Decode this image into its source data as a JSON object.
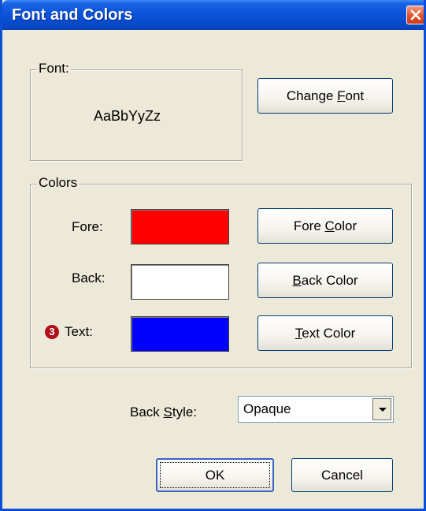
{
  "window": {
    "title": "Font and Colors"
  },
  "font_group": {
    "legend": "Font:",
    "sample_text": "AaBbYyZz",
    "change_font_button": {
      "pre": "Change ",
      "mnemonic": "F",
      "post": "ont"
    }
  },
  "colors_group": {
    "legend": "Colors",
    "rows": [
      {
        "label": "Fore:",
        "color": "#ff0000",
        "button": {
          "pre": "Fore ",
          "mnemonic": "C",
          "post": "olor"
        }
      },
      {
        "label": "Back:",
        "color": "#ffffff",
        "button": {
          "pre": "",
          "mnemonic": "B",
          "post": "ack Color"
        }
      },
      {
        "label": "Text:",
        "color": "#0000ff",
        "button": {
          "pre": "",
          "mnemonic": "T",
          "post": "ext Color"
        }
      }
    ],
    "callout_badge": "3"
  },
  "back_style": {
    "label_pre": "Back ",
    "label_mnemonic": "S",
    "label_post": "tyle:",
    "selected": "Opaque"
  },
  "buttons": {
    "ok": "OK",
    "cancel": "Cancel"
  },
  "colors": {
    "titlebar": "#0a4fd6",
    "dialog_bg": "#ece9d8",
    "badge": "#b0101a"
  }
}
